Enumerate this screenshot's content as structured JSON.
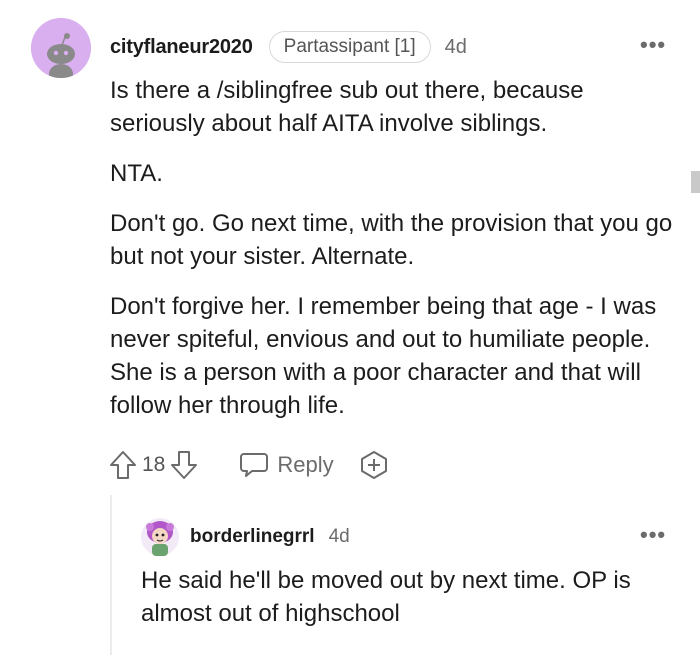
{
  "comment": {
    "username": "cityflaneur2020",
    "flair": "Partassipant [1]",
    "time": "4d",
    "more": "•••",
    "paragraphs": [
      "Is there a /siblingfree sub out there, because seriously about half AITA involve siblings.",
      "NTA.",
      "Don't go. Go next time, with the provision that you go but not your sister. Alternate.",
      "Don't forgive her. I remember being that age - I was never spiteful, envious and out to humiliate people. She is a person with a poor character and that will follow her through life."
    ],
    "votes": "18",
    "reply_label": "Reply",
    "icons": {
      "upvote": "upvote-arrow-icon",
      "downvote": "downvote-arrow-icon",
      "reply": "speech-bubble-icon",
      "award": "award-plus-icon"
    }
  },
  "reply": {
    "username": "borderlinegrrl",
    "time": "4d",
    "more": "•••",
    "text": "He said he'll be moved out by next time. OP is almost out of highschool"
  },
  "colors": {
    "avatar_bg": "#d9aff0",
    "text": "#1c1c1c",
    "muted": "#6b6b6b"
  }
}
